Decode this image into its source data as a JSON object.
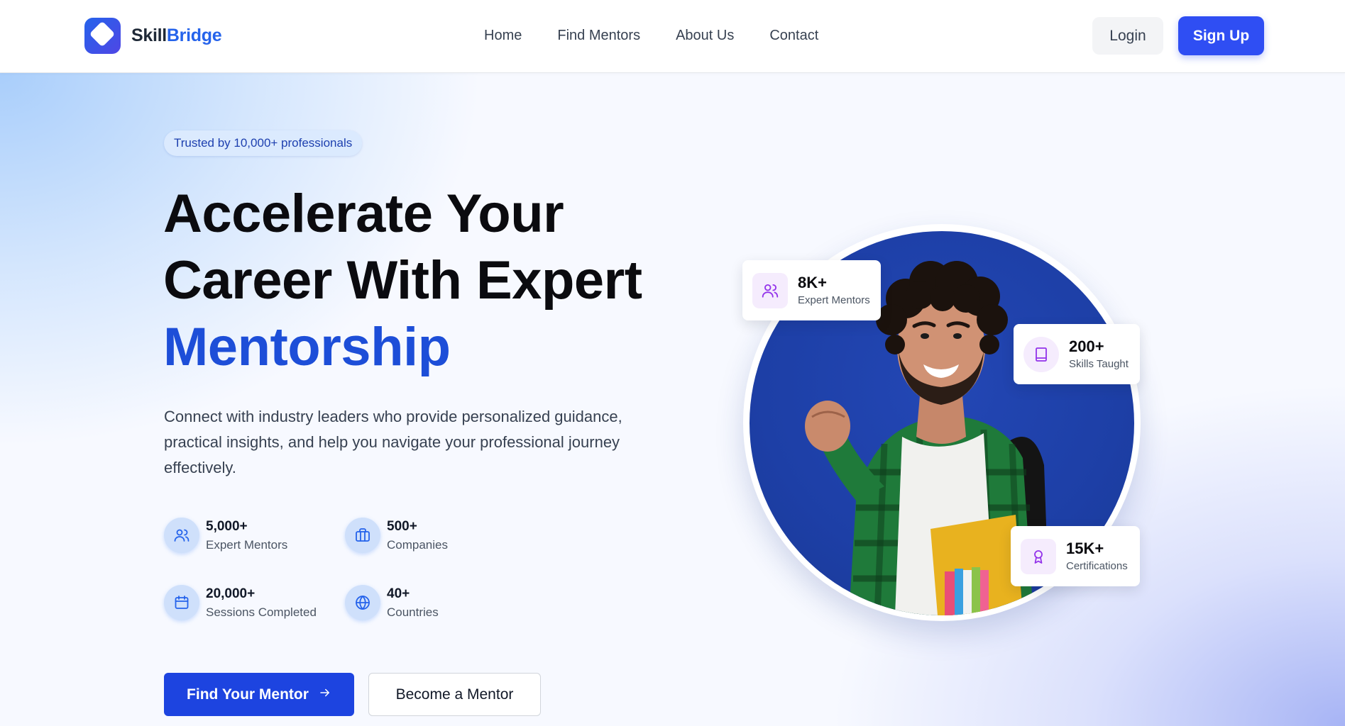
{
  "header": {
    "logo": {
      "part1": "Skill",
      "part2": "Bridge"
    },
    "nav": [
      "Home",
      "Find Mentors",
      "About Us",
      "Contact"
    ],
    "login_label": "Login",
    "signup_label": "Sign Up"
  },
  "hero": {
    "badge": "Trusted by 10,000+ professionals",
    "title_line1": "Accelerate Your",
    "title_line2": "Career With Expert",
    "title_accent": "Mentorship",
    "description": "Connect with industry leaders who provide personalized guidance, practical insights, and help you navigate your professional journey effectively.",
    "stats": [
      {
        "value": "5,000+",
        "label": "Expert Mentors",
        "icon": "users-icon"
      },
      {
        "value": "500+",
        "label": "Companies",
        "icon": "briefcase-icon"
      },
      {
        "value": "20,000+",
        "label": "Sessions Completed",
        "icon": "calendar-icon"
      },
      {
        "value": "40+",
        "label": "Countries",
        "icon": "globe-icon"
      }
    ],
    "primary_cta": "Find Your Mentor",
    "secondary_cta": "Become a Mentor"
  },
  "cards": [
    {
      "value": "8K+",
      "label": "Expert Mentors",
      "icon": "users-icon"
    },
    {
      "value": "200+",
      "label": "Skills Taught",
      "icon": "book-icon"
    },
    {
      "value": "15K+",
      "label": "Certifications",
      "icon": "award-icon"
    }
  ],
  "colors": {
    "brand": "#2563eb",
    "signup": "#2f4ef3",
    "cta": "#1d44e0",
    "accent_purple": "#9333ea",
    "portrait_bg": "#1d3fa6"
  }
}
